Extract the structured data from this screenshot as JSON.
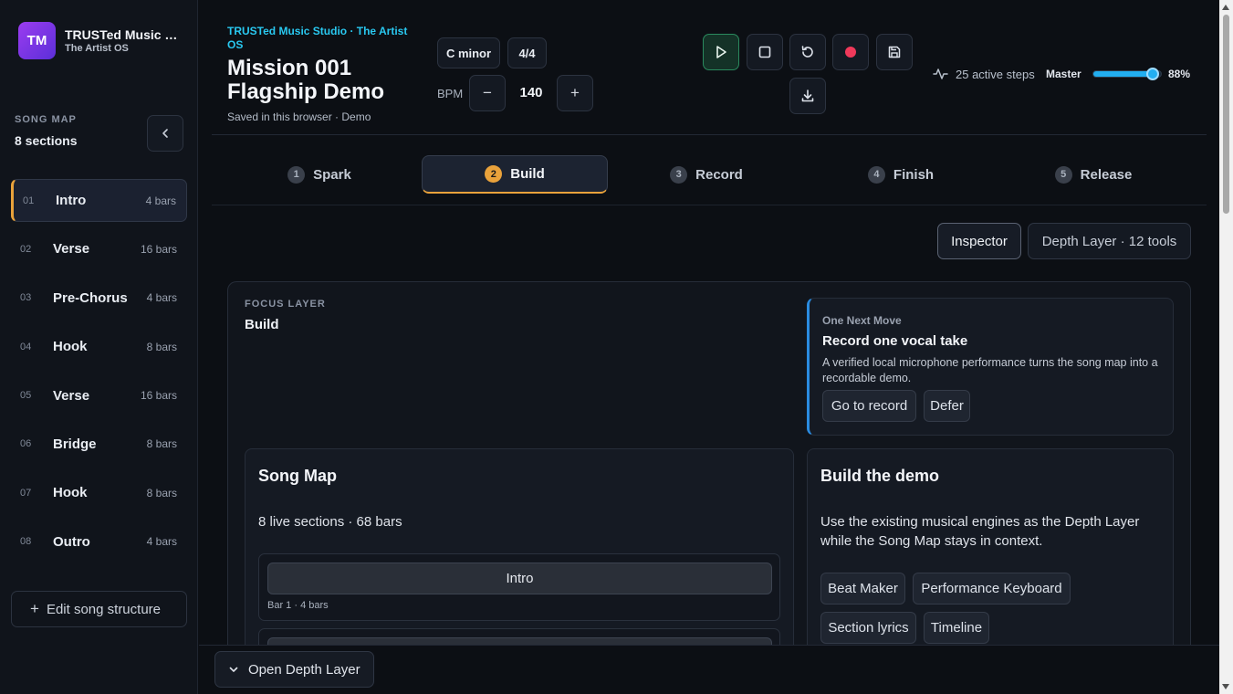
{
  "brand": {
    "logo": "TM",
    "title": "TRUSTed Music S...",
    "subtitle": "The Artist OS"
  },
  "sidebar": {
    "label": "SONG MAP",
    "count": "8 sections",
    "sections": [
      {
        "num": "01",
        "name": "Intro",
        "bars": "4 bars",
        "active": true
      },
      {
        "num": "02",
        "name": "Verse",
        "bars": "16 bars"
      },
      {
        "num": "03",
        "name": "Pre-Chorus",
        "bars": "4 bars"
      },
      {
        "num": "04",
        "name": "Hook",
        "bars": "8 bars"
      },
      {
        "num": "05",
        "name": "Verse",
        "bars": "16 bars"
      },
      {
        "num": "06",
        "name": "Bridge",
        "bars": "8 bars"
      },
      {
        "num": "07",
        "name": "Hook",
        "bars": "8 bars"
      },
      {
        "num": "08",
        "name": "Outro",
        "bars": "4 bars"
      }
    ],
    "edit_label": "Edit song structure"
  },
  "header": {
    "app_title": "TRUSTed Music Studio · The Artist OS",
    "project_title": "Mission 001 Flagship Demo",
    "saved": "Saved in this browser · Demo",
    "key": "C minor",
    "time_sig": "4/4",
    "bpm_label": "BPM",
    "bpm": "140",
    "minus": "−",
    "plus": "+",
    "active_steps": "25 active steps",
    "master_label": "Master",
    "master_pct": "88%",
    "master_level": 0.88
  },
  "tabs": [
    {
      "num": "1",
      "label": "Spark"
    },
    {
      "num": "2",
      "label": "Build",
      "active": true
    },
    {
      "num": "3",
      "label": "Record"
    },
    {
      "num": "4",
      "label": "Finish"
    },
    {
      "num": "5",
      "label": "Release"
    }
  ],
  "toolbar": {
    "inspector": "Inspector",
    "depth_layer": "Depth Layer · 12 tools"
  },
  "focus": {
    "label": "FOCUS LAYER",
    "value": "Build"
  },
  "next_move": {
    "label": "One Next Move",
    "title": "Record one vocal take",
    "desc": "A verified local microphone performance turns the song map into a recordable demo.",
    "go": "Go to record",
    "defer": "Defer"
  },
  "song_map_card": {
    "title": "Song Map",
    "summary": "8 live sections · 68 bars",
    "first_section": "Intro",
    "first_meta": "Bar 1 · 4 bars"
  },
  "build_card": {
    "title": "Build the demo",
    "desc": "Use the existing musical engines as the Depth Layer while the Song Map stays in context.",
    "tools": [
      "Beat Maker",
      "Performance Keyboard",
      "Section lyrics",
      "Timeline"
    ]
  },
  "bottom": {
    "open_depth": "Open Depth Layer"
  },
  "colors": {
    "accent": "#e9a23b",
    "cyan": "#29c8f0",
    "record": "#f0395a",
    "play": "#2a8a5e",
    "slider": "#22aef0"
  }
}
